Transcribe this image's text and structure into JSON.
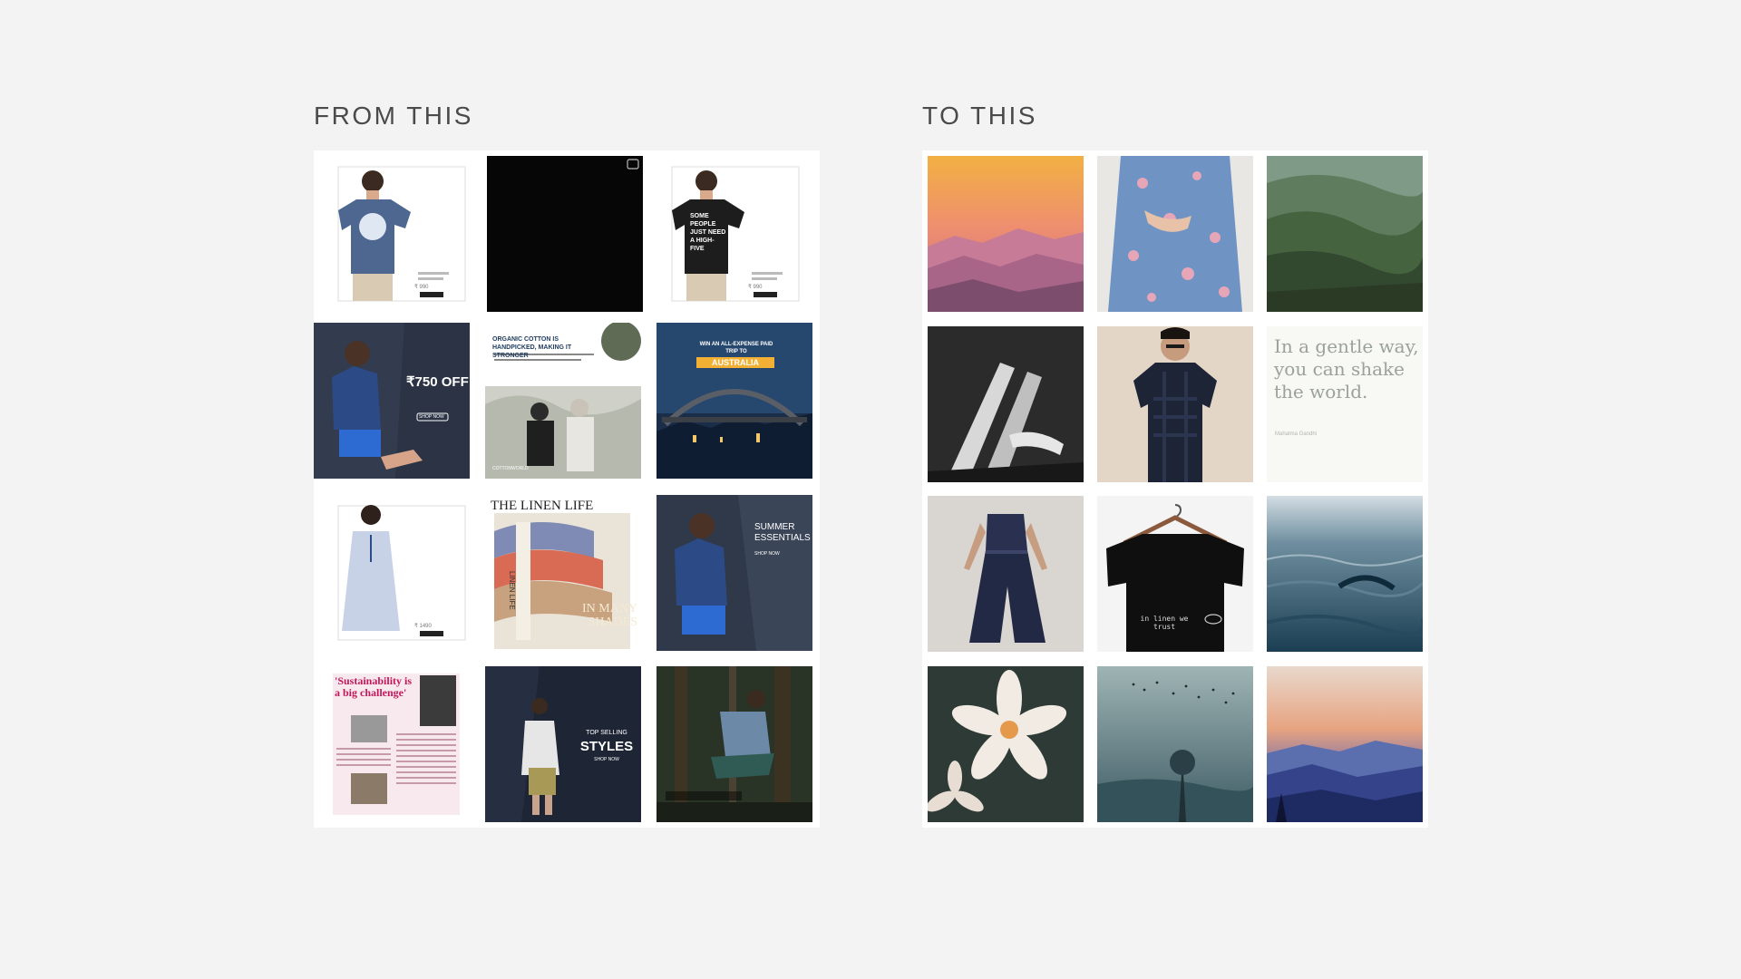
{
  "headings": {
    "before": "FROM THIS",
    "after": "TO THIS"
  },
  "before_tiles": {
    "tee_1": {
      "price": "₹ 990"
    },
    "tee_2": {
      "print": "SOME PEOPLE JUST NEED A HIGH-FIVE",
      "price": "₹ 990"
    },
    "checks_ad": {
      "amount": "₹750 OFF",
      "cta": "SHOP NOW"
    },
    "organic_ad": {
      "title": "ORGANIC COTTON IS HANDPICKED, MAKING IT STRONGER",
      "brand": "COTTONWORLD"
    },
    "australia_ad": {
      "line1": "WIN AN ALL-EXPENSE PAID TRIP TO",
      "line2": "AUSTRALIA"
    },
    "dress_tile": {
      "price": "₹ 1490"
    },
    "linen_ad": {
      "title": "THE LINEN LIFE",
      "tag": "LINEN LIFE",
      "subtitle": "IN MANY SHADES"
    },
    "summer_ad": {
      "title": "SUMMER ESSENTIALS",
      "cta": "SHOP NOW"
    },
    "press_tile": {
      "headline": "'Sustainability is a big challenge'"
    },
    "styles_ad": {
      "line1": "TOP SELLING",
      "line2": "STYLES",
      "cta": "SHOP NOW"
    }
  },
  "after_tiles": {
    "tee_print": "in linen we trust",
    "quote": {
      "text": "In a gentle way, you can shake the world.",
      "author": "Mahatma Gandhi"
    }
  },
  "colors": {
    "background": "#f3f3f3",
    "heading": "#4a4a4a",
    "panel": "#ffffff"
  }
}
